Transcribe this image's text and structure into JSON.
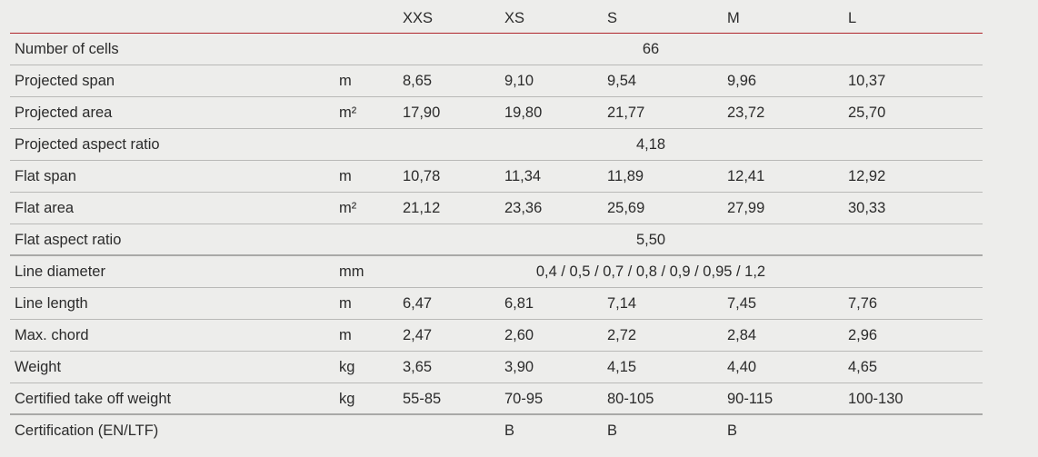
{
  "header": {
    "sizes": [
      "XXS",
      "XS",
      "S",
      "M",
      "L"
    ]
  },
  "rows": [
    {
      "label": "Number of cells",
      "unit": "",
      "span": "66"
    },
    {
      "label": "Projected span",
      "unit": "m",
      "values": [
        "8,65",
        "9,10",
        "9,54",
        "9,96",
        "10,37"
      ]
    },
    {
      "label": "Projected area",
      "unit": "m²",
      "values": [
        "17,90",
        "19,80",
        "21,77",
        "23,72",
        "25,70"
      ]
    },
    {
      "label": "Projected aspect ratio",
      "unit": "",
      "span": "4,18"
    },
    {
      "label": "Flat span",
      "unit": "m",
      "values": [
        "10,78",
        "11,34",
        "11,89",
        "12,41",
        "12,92"
      ]
    },
    {
      "label": "Flat area",
      "unit": "m²",
      "values": [
        "21,12",
        "23,36",
        "25,69",
        "27,99",
        "30,33"
      ]
    },
    {
      "label": "Flat aspect ratio",
      "unit": "",
      "span": "5,50"
    },
    {
      "label": "Line diameter",
      "unit": "mm",
      "span": "0,4 / 0,5 / 0,7 / 0,8 / 0,9 / 0,95 / 1,2"
    },
    {
      "label": "Line length",
      "unit": "m",
      "values": [
        "6,47",
        "6,81",
        "7,14",
        "7,45",
        "7,76"
      ]
    },
    {
      "label": "Max. chord",
      "unit": "m",
      "values": [
        "2,47",
        "2,60",
        "2,72",
        "2,84",
        "2,96"
      ]
    },
    {
      "label": "Weight",
      "unit": "kg",
      "values": [
        "3,65",
        "3,90",
        "4,15",
        "4,40",
        "4,65"
      ]
    },
    {
      "label": "Certified take off weight",
      "unit": "kg",
      "values": [
        "55-85",
        "70-95",
        "80-105",
        "90-115",
        "100-130"
      ]
    },
    {
      "label": "Certification (EN/LTF)",
      "unit": "",
      "values": [
        "",
        "B",
        "B",
        "B",
        ""
      ]
    }
  ]
}
